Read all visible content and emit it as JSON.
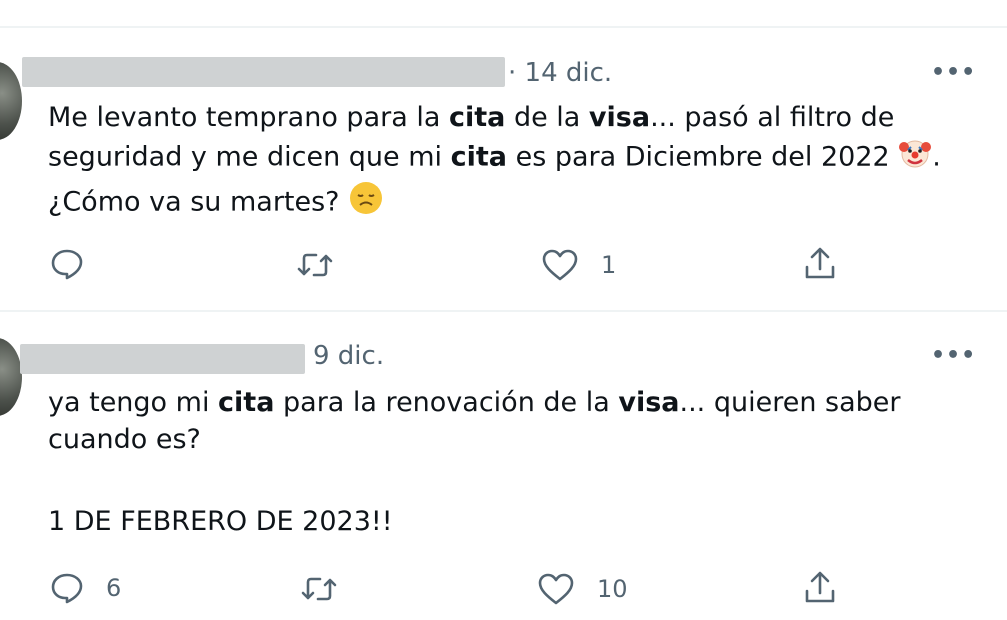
{
  "tweets": [
    {
      "date": "· 14 dic.",
      "more": "•••",
      "text": {
        "l1_a": "Me levanto temprano para la ",
        "l1_b": "cita",
        "l1_c": " de la ",
        "l1_d": "visa",
        "l1_e": "... pasó al filtro de",
        "l2_a": "seguridad y me dicen que mi ",
        "l2_b": "cita",
        "l2_c": " es para Diciembre del 2022 ",
        "l2_e": ".",
        "l3_a": "¿Cómo va su martes? "
      },
      "emoji_1": "clown-face",
      "emoji_2": "disappointed-face",
      "reply_count": "",
      "retweet_count": "",
      "like_count": "1"
    },
    {
      "date": "9 dic.",
      "more": "•••",
      "text": {
        "l1_a": "ya tengo mi ",
        "l1_b": "cita",
        "l1_c": " para la renovación de la ",
        "l1_d": "visa",
        "l1_e": "... quieren saber",
        "l2": "cuando es?",
        "l4": "1 DE FEBRERO DE 2023!!"
      },
      "reply_count": "6",
      "retweet_count": "",
      "like_count": "10"
    }
  ],
  "colors": {
    "text": "#0f1419",
    "secondary": "#536471",
    "divider": "#eff3f4",
    "emoji_yellow": "#f7c538"
  }
}
